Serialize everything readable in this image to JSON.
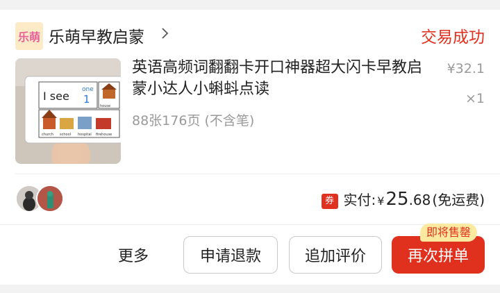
{
  "shop": {
    "logo_text": "乐萌",
    "name": "乐萌早教启蒙",
    "status": "交易成功"
  },
  "product": {
    "title": "英语高频词翻翻卡开口神器超大闪卡早教启蒙小达人小蝌蚪点读",
    "spec": "88张176页 (不含笔)",
    "price": "¥32.1",
    "quantity": "×1",
    "thumbnail_text": {
      "main": "I see",
      "word": "one",
      "number": "1",
      "house": "house",
      "labels": [
        "church",
        "school",
        "hospital",
        "firehouse"
      ]
    }
  },
  "payment": {
    "coupon_icon": "券",
    "label": "实付:",
    "currency": "¥",
    "amount_int": "25",
    "amount_dec": ".68",
    "shipping_note": "(免运费)"
  },
  "actions": {
    "more": "更多",
    "refund": "申请退款",
    "review": "追加评价",
    "rebuy": "再次拼单",
    "rebuy_badge": "即将售罄"
  },
  "colors": {
    "accent": "#e0301e",
    "badge_bg": "#fde9a0"
  }
}
